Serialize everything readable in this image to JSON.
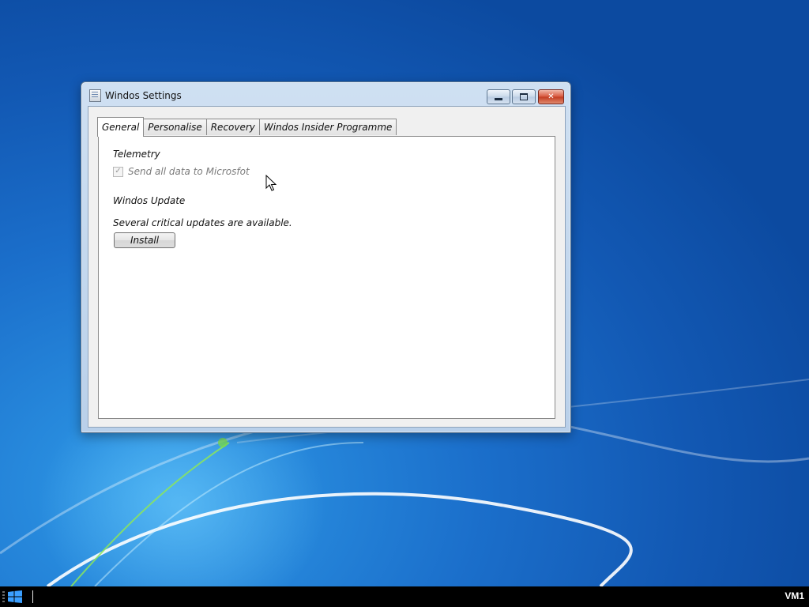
{
  "window": {
    "title": "Windos Settings",
    "controls": {
      "minimize": "minimize",
      "maximize": "maximize",
      "close": "✕"
    }
  },
  "tabs": [
    {
      "label": "General",
      "active": true
    },
    {
      "label": "Personalise",
      "active": false
    },
    {
      "label": "Recovery",
      "active": false
    },
    {
      "label": "Windos Insider Programme",
      "active": false
    }
  ],
  "general": {
    "telemetry_heading": "Telemetry",
    "telemetry_checkbox_label": "Send all data to Microsfot",
    "telemetry_checkbox_checked": true,
    "update_heading": "Windos Update",
    "update_status": "Several critical updates are available.",
    "install_button": "Install"
  },
  "taskbar": {
    "vm_label": "VM1"
  },
  "icons": {
    "window": "settings-app-icon",
    "start": "windows-logo-icon"
  }
}
